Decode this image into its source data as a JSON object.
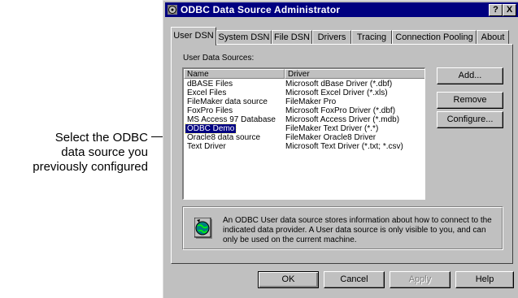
{
  "callout": {
    "lines": [
      "Select the ODBC",
      "data source you",
      "previously configured"
    ]
  },
  "window": {
    "title": "ODBC Data Source Administrator",
    "help_button": "?",
    "close_button": "X"
  },
  "tabs": [
    {
      "label": "User DSN",
      "active": true
    },
    {
      "label": "System DSN"
    },
    {
      "label": "File DSN"
    },
    {
      "label": "Drivers"
    },
    {
      "label": "Tracing"
    },
    {
      "label": "Connection Pooling"
    },
    {
      "label": "About"
    }
  ],
  "panel": {
    "section_label": "User Data Sources:",
    "columns": [
      "Name",
      "Driver"
    ],
    "rows": [
      {
        "name": "dBASE Files",
        "driver": "Microsoft dBase Driver (*.dbf)"
      },
      {
        "name": "Excel Files",
        "driver": "Microsoft Excel Driver (*.xls)"
      },
      {
        "name": "FileMaker data source",
        "driver": "FileMaker Pro"
      },
      {
        "name": "FoxPro Files",
        "driver": "Microsoft FoxPro Driver (*.dbf)"
      },
      {
        "name": "MS Access 97 Database",
        "driver": "Microsoft Access Driver (*.mdb)"
      },
      {
        "name": "ODBC Demo",
        "driver": "FileMaker Text Driver (*.*)",
        "selected": true
      },
      {
        "name": "Oracle8 data source",
        "driver": "FileMaker Oracle8 Driver"
      },
      {
        "name": "Text Driver",
        "driver": "Microsoft Text Driver (*.txt; *.csv)"
      }
    ],
    "side_buttons": {
      "add": "Add...",
      "remove": "Remove",
      "configure": "Configure..."
    },
    "info_text": "An ODBC User data source stores information about how to connect to the indicated data provider.  A User data source is only visible to you, and can only be used on the current machine."
  },
  "footer_buttons": {
    "ok": "OK",
    "cancel": "Cancel",
    "apply": "Apply",
    "help": "Help"
  },
  "colors": {
    "titlebar": "#000080",
    "face": "#c0c0c0",
    "selection": "#000080"
  },
  "icons": {
    "app": "odbc-admin-icon",
    "info": "globe-info-icon"
  }
}
